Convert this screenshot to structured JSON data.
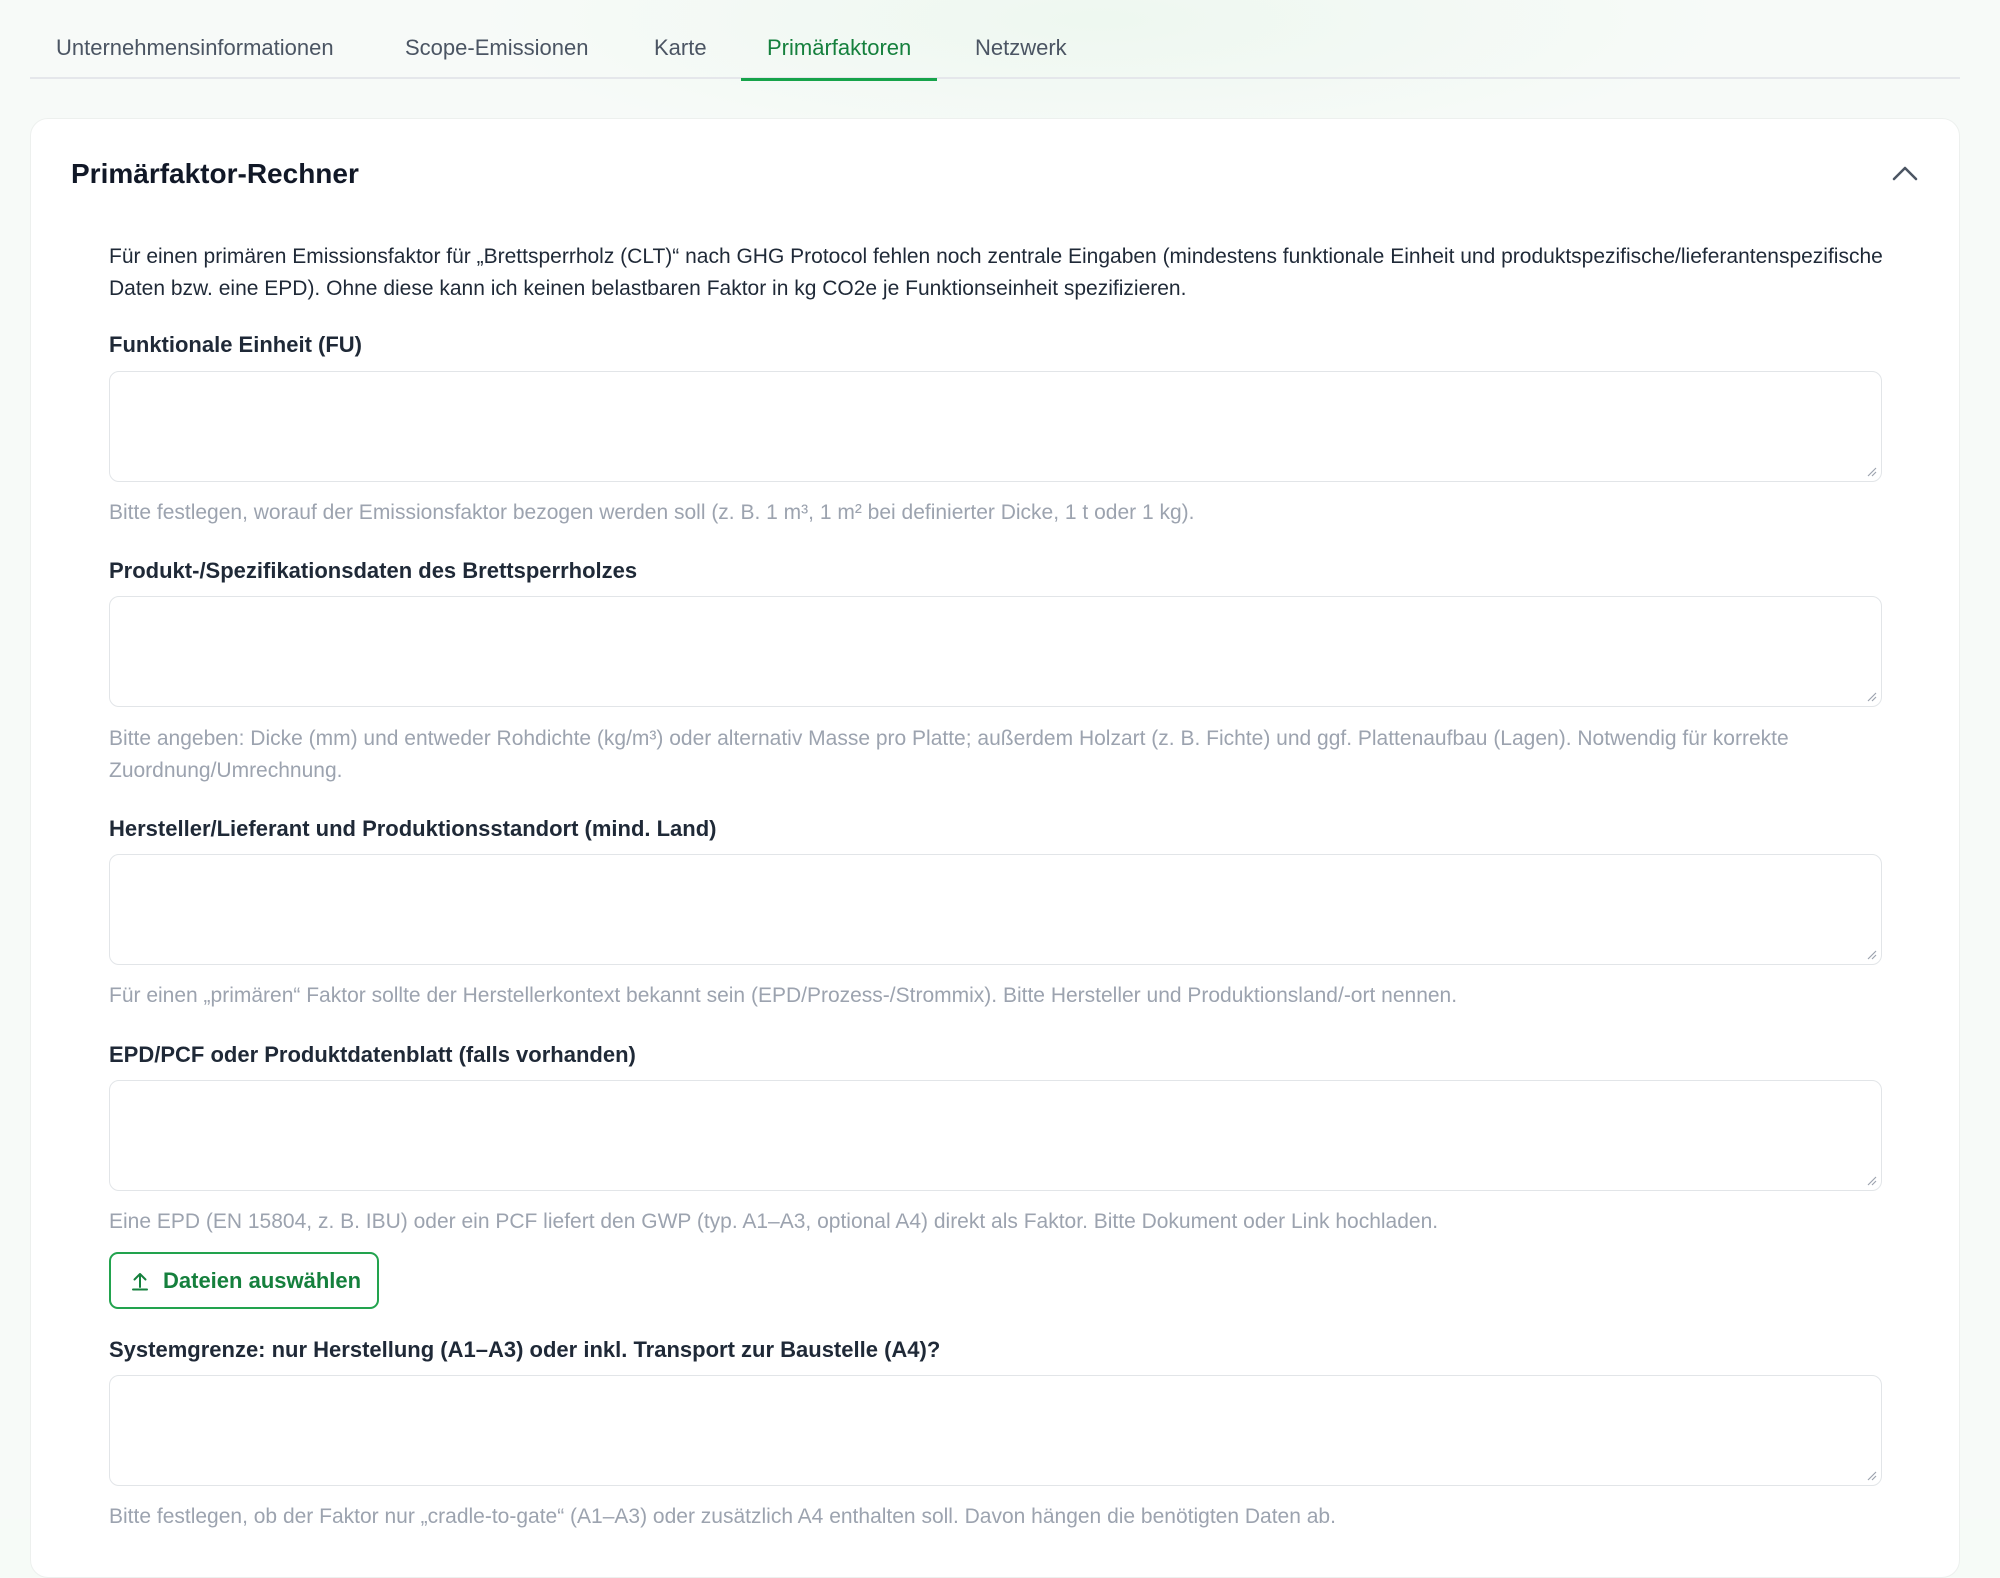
{
  "tabs": [
    {
      "label": "Unternehmensinformationen",
      "active": false
    },
    {
      "label": "Scope-Emissionen",
      "active": false
    },
    {
      "label": "Karte",
      "active": false
    },
    {
      "label": "Primärfaktoren",
      "active": true
    },
    {
      "label": "Netzwerk",
      "active": false
    }
  ],
  "accent_color": "#16a34a",
  "card": {
    "title": "Primärfaktor-Rechner",
    "collapse_icon": "chevron-up-icon",
    "intro": "Für einen primären Emissionsfaktor für „Brettsperrholz (CLT)“ nach GHG Protocol fehlen noch zentrale Eingaben (mindestens funktionale Einheit und produktspezifische/lieferantenspezifische Daten bzw. eine EPD). Ohne diese kann ich keinen belastbaren Faktor in kg CO2e je Funktionseinheit spezifizieren."
  },
  "fields": [
    {
      "label": "Funktionale Einheit (FU)",
      "value": "",
      "hint": "Bitte festlegen, worauf der Emissionsfaktor bezogen werden soll (z. B. 1 m³, 1 m² bei definierter Dicke, 1 t oder 1 kg)."
    },
    {
      "label": "Produkt-/Spezifikationsdaten des Brettsperrholzes",
      "value": "",
      "hint": "Bitte angeben: Dicke (mm) und entweder Rohdichte (kg/m³) oder alternativ Masse pro Platte; außerdem Holzart (z. B. Fichte) und ggf. Plattenaufbau (Lagen). Notwendig für korrekte Zuordnung/Umrechnung."
    },
    {
      "label": "Hersteller/Lieferant und Produktionsstandort (mind. Land)",
      "value": "",
      "hint": "Für einen „primären“ Faktor sollte der Herstellerkontext bekannt sein (EPD/Prozess-/Strommix). Bitte Hersteller und Produktionsland/-ort nennen."
    },
    {
      "label": "EPD/PCF oder Produktdatenblatt (falls vorhanden)",
      "value": "",
      "hint": "Eine EPD (EN 15804, z. B. IBU) oder ein PCF liefert den GWP (typ. A1–A3, optional A4) direkt als Faktor. Bitte Dokument oder Link hochladen."
    },
    {
      "label": "Systemgrenze: nur Herstellung (A1–A3) oder inkl. Transport zur Baustelle (A4)?",
      "value": "",
      "hint": "Bitte festlegen, ob der Faktor nur „cradle-to-gate“ (A1–A3) oder zusätzlich A4 enthalten soll. Davon hängen die benötigten Daten ab."
    }
  ],
  "upload": {
    "label": "Dateien auswählen",
    "icon": "upload-icon"
  }
}
